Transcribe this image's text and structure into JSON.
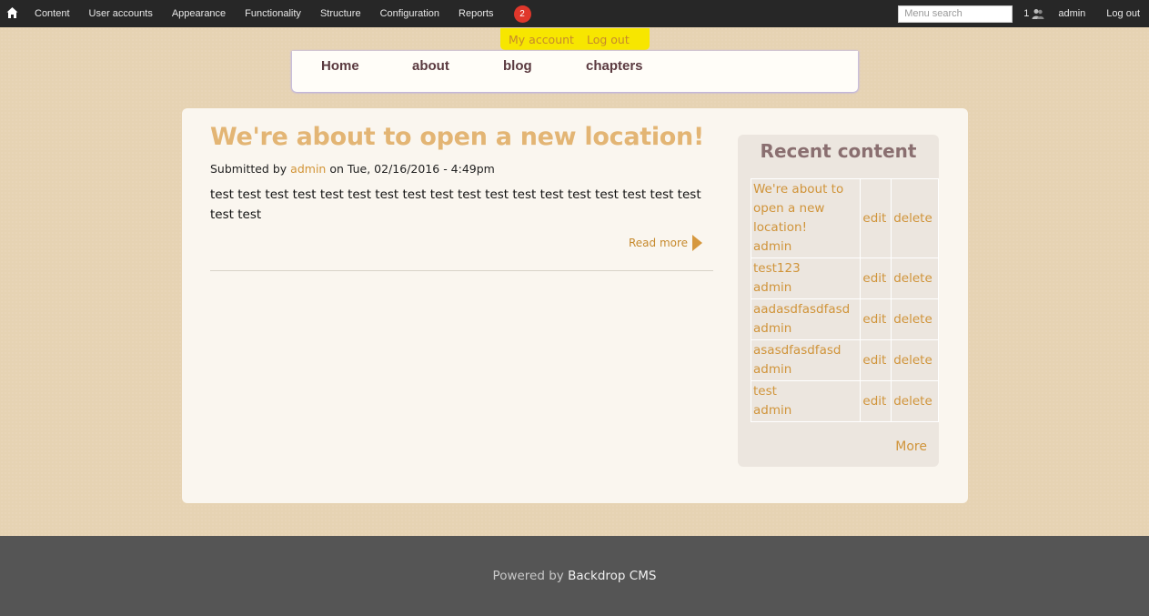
{
  "admin_bar": {
    "menu": [
      "Content",
      "User accounts",
      "Appearance",
      "Functionality",
      "Structure",
      "Configuration",
      "Reports"
    ],
    "notification_count": "2",
    "search_placeholder": "Menu search",
    "user_count": "1",
    "username": "admin",
    "logout": "Log out"
  },
  "account_tab": {
    "my_account": "My account",
    "log_out": "Log out"
  },
  "main_nav": [
    "Home",
    "about",
    "blog",
    "chapters"
  ],
  "post": {
    "title": "We're about to open a new location!",
    "submitted_prefix": "Submitted by",
    "author": "admin",
    "submitted_suffix": "on Tue, 02/16/2016 - 4:49pm",
    "body": "test test test test test test test test test test test test test test test test test test test test",
    "read_more": "Read more"
  },
  "recent_content": {
    "heading": "Recent content",
    "rows": [
      {
        "title": "We're about to open a new location!",
        "author": "admin",
        "edit": "edit",
        "delete": "delete"
      },
      {
        "title": "test123",
        "author": "admin",
        "edit": "edit",
        "delete": "delete"
      },
      {
        "title": "aadasdfasdfasd",
        "author": "admin",
        "edit": "edit",
        "delete": "delete"
      },
      {
        "title": "asasdfasdfasd",
        "author": "admin",
        "edit": "edit",
        "delete": "delete"
      },
      {
        "title": "test",
        "author": "admin",
        "edit": "edit",
        "delete": "delete"
      }
    ],
    "more": "More"
  },
  "footer": {
    "prefix": "Powered by",
    "cms": "Backdrop CMS"
  },
  "colors": {
    "background": "#e6d3b3",
    "admin_bar": "#272727",
    "accent": "#d0943a",
    "title": "#e3b574",
    "nav_text": "#5b3a40",
    "account_tab": "#f7e600",
    "footer": "#555555"
  }
}
